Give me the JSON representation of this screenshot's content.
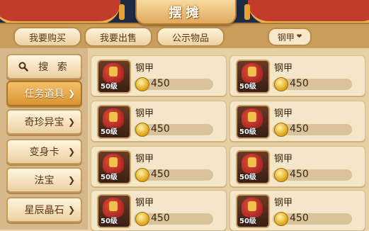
{
  "header": {
    "title": "摆摊",
    "tabs": [
      {
        "label": "我要购买"
      },
      {
        "label": "我要出售"
      },
      {
        "label": "公示物品"
      }
    ],
    "filter": {
      "selected": "钢甲"
    }
  },
  "sidebar": {
    "search_label": "搜 索",
    "items": [
      {
        "label": "任务道具",
        "active": true
      },
      {
        "label": "奇珍异宝",
        "active": false
      },
      {
        "label": "变身卡",
        "active": false
      },
      {
        "label": "法宝",
        "active": false
      },
      {
        "label": "星辰晶石",
        "active": false
      }
    ]
  },
  "listings": [
    {
      "name": "钢甲",
      "level": "50级",
      "price": "450"
    },
    {
      "name": "钢甲",
      "level": "50级",
      "price": "450"
    },
    {
      "name": "钢甲",
      "level": "50级",
      "price": "450"
    },
    {
      "name": "钢甲",
      "level": "50级",
      "price": "450"
    },
    {
      "name": "钢甲",
      "level": "50级",
      "price": "450"
    },
    {
      "name": "钢甲",
      "level": "50级",
      "price": "450"
    },
    {
      "name": "钢甲",
      "level": "50级",
      "price": "450"
    },
    {
      "name": "钢甲",
      "level": "50级",
      "price": "450"
    }
  ],
  "colors": {
    "accent": "#d99433",
    "panel": "#f4e6c8",
    "banner": "#c23b2b"
  }
}
